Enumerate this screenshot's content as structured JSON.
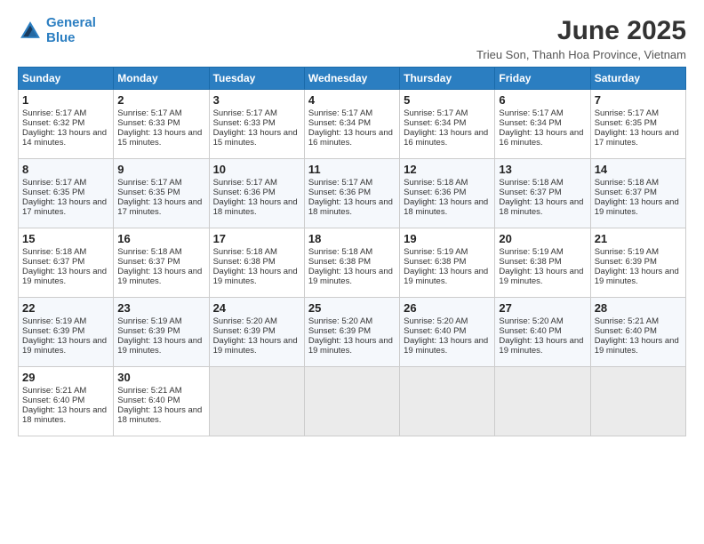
{
  "logo": {
    "line1": "General",
    "line2": "Blue"
  },
  "title": "June 2025",
  "subtitle": "Trieu Son, Thanh Hoa Province, Vietnam",
  "days_of_week": [
    "Sunday",
    "Monday",
    "Tuesday",
    "Wednesday",
    "Thursday",
    "Friday",
    "Saturday"
  ],
  "weeks": [
    [
      {
        "day": "1",
        "sunrise": "Sunrise: 5:17 AM",
        "sunset": "Sunset: 6:32 PM",
        "daylight": "Daylight: 13 hours and 14 minutes."
      },
      {
        "day": "2",
        "sunrise": "Sunrise: 5:17 AM",
        "sunset": "Sunset: 6:33 PM",
        "daylight": "Daylight: 13 hours and 15 minutes."
      },
      {
        "day": "3",
        "sunrise": "Sunrise: 5:17 AM",
        "sunset": "Sunset: 6:33 PM",
        "daylight": "Daylight: 13 hours and 15 minutes."
      },
      {
        "day": "4",
        "sunrise": "Sunrise: 5:17 AM",
        "sunset": "Sunset: 6:34 PM",
        "daylight": "Daylight: 13 hours and 16 minutes."
      },
      {
        "day": "5",
        "sunrise": "Sunrise: 5:17 AM",
        "sunset": "Sunset: 6:34 PM",
        "daylight": "Daylight: 13 hours and 16 minutes."
      },
      {
        "day": "6",
        "sunrise": "Sunrise: 5:17 AM",
        "sunset": "Sunset: 6:34 PM",
        "daylight": "Daylight: 13 hours and 16 minutes."
      },
      {
        "day": "7",
        "sunrise": "Sunrise: 5:17 AM",
        "sunset": "Sunset: 6:35 PM",
        "daylight": "Daylight: 13 hours and 17 minutes."
      }
    ],
    [
      {
        "day": "8",
        "sunrise": "Sunrise: 5:17 AM",
        "sunset": "Sunset: 6:35 PM",
        "daylight": "Daylight: 13 hours and 17 minutes."
      },
      {
        "day": "9",
        "sunrise": "Sunrise: 5:17 AM",
        "sunset": "Sunset: 6:35 PM",
        "daylight": "Daylight: 13 hours and 17 minutes."
      },
      {
        "day": "10",
        "sunrise": "Sunrise: 5:17 AM",
        "sunset": "Sunset: 6:36 PM",
        "daylight": "Daylight: 13 hours and 18 minutes."
      },
      {
        "day": "11",
        "sunrise": "Sunrise: 5:17 AM",
        "sunset": "Sunset: 6:36 PM",
        "daylight": "Daylight: 13 hours and 18 minutes."
      },
      {
        "day": "12",
        "sunrise": "Sunrise: 5:18 AM",
        "sunset": "Sunset: 6:36 PM",
        "daylight": "Daylight: 13 hours and 18 minutes."
      },
      {
        "day": "13",
        "sunrise": "Sunrise: 5:18 AM",
        "sunset": "Sunset: 6:37 PM",
        "daylight": "Daylight: 13 hours and 18 minutes."
      },
      {
        "day": "14",
        "sunrise": "Sunrise: 5:18 AM",
        "sunset": "Sunset: 6:37 PM",
        "daylight": "Daylight: 13 hours and 19 minutes."
      }
    ],
    [
      {
        "day": "15",
        "sunrise": "Sunrise: 5:18 AM",
        "sunset": "Sunset: 6:37 PM",
        "daylight": "Daylight: 13 hours and 19 minutes."
      },
      {
        "day": "16",
        "sunrise": "Sunrise: 5:18 AM",
        "sunset": "Sunset: 6:37 PM",
        "daylight": "Daylight: 13 hours and 19 minutes."
      },
      {
        "day": "17",
        "sunrise": "Sunrise: 5:18 AM",
        "sunset": "Sunset: 6:38 PM",
        "daylight": "Daylight: 13 hours and 19 minutes."
      },
      {
        "day": "18",
        "sunrise": "Sunrise: 5:18 AM",
        "sunset": "Sunset: 6:38 PM",
        "daylight": "Daylight: 13 hours and 19 minutes."
      },
      {
        "day": "19",
        "sunrise": "Sunrise: 5:19 AM",
        "sunset": "Sunset: 6:38 PM",
        "daylight": "Daylight: 13 hours and 19 minutes."
      },
      {
        "day": "20",
        "sunrise": "Sunrise: 5:19 AM",
        "sunset": "Sunset: 6:38 PM",
        "daylight": "Daylight: 13 hours and 19 minutes."
      },
      {
        "day": "21",
        "sunrise": "Sunrise: 5:19 AM",
        "sunset": "Sunset: 6:39 PM",
        "daylight": "Daylight: 13 hours and 19 minutes."
      }
    ],
    [
      {
        "day": "22",
        "sunrise": "Sunrise: 5:19 AM",
        "sunset": "Sunset: 6:39 PM",
        "daylight": "Daylight: 13 hours and 19 minutes."
      },
      {
        "day": "23",
        "sunrise": "Sunrise: 5:19 AM",
        "sunset": "Sunset: 6:39 PM",
        "daylight": "Daylight: 13 hours and 19 minutes."
      },
      {
        "day": "24",
        "sunrise": "Sunrise: 5:20 AM",
        "sunset": "Sunset: 6:39 PM",
        "daylight": "Daylight: 13 hours and 19 minutes."
      },
      {
        "day": "25",
        "sunrise": "Sunrise: 5:20 AM",
        "sunset": "Sunset: 6:39 PM",
        "daylight": "Daylight: 13 hours and 19 minutes."
      },
      {
        "day": "26",
        "sunrise": "Sunrise: 5:20 AM",
        "sunset": "Sunset: 6:40 PM",
        "daylight": "Daylight: 13 hours and 19 minutes."
      },
      {
        "day": "27",
        "sunrise": "Sunrise: 5:20 AM",
        "sunset": "Sunset: 6:40 PM",
        "daylight": "Daylight: 13 hours and 19 minutes."
      },
      {
        "day": "28",
        "sunrise": "Sunrise: 5:21 AM",
        "sunset": "Sunset: 6:40 PM",
        "daylight": "Daylight: 13 hours and 19 minutes."
      }
    ],
    [
      {
        "day": "29",
        "sunrise": "Sunrise: 5:21 AM",
        "sunset": "Sunset: 6:40 PM",
        "daylight": "Daylight: 13 hours and 18 minutes."
      },
      {
        "day": "30",
        "sunrise": "Sunrise: 5:21 AM",
        "sunset": "Sunset: 6:40 PM",
        "daylight": "Daylight: 13 hours and 18 minutes."
      },
      {
        "day": "",
        "sunrise": "",
        "sunset": "",
        "daylight": ""
      },
      {
        "day": "",
        "sunrise": "",
        "sunset": "",
        "daylight": ""
      },
      {
        "day": "",
        "sunrise": "",
        "sunset": "",
        "daylight": ""
      },
      {
        "day": "",
        "sunrise": "",
        "sunset": "",
        "daylight": ""
      },
      {
        "day": "",
        "sunrise": "",
        "sunset": "",
        "daylight": ""
      }
    ]
  ]
}
